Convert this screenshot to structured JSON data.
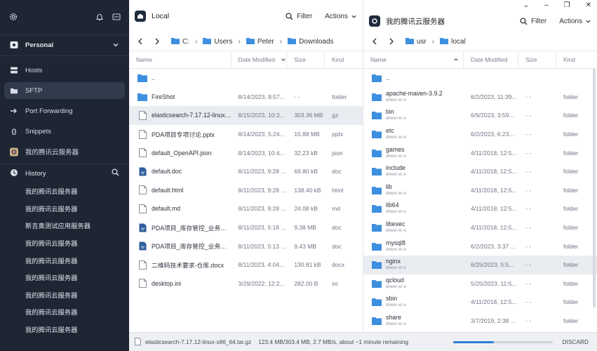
{
  "sidebar": {
    "personal_label": "Personal",
    "nav": [
      {
        "label": "Hosts",
        "icon": "hosts-icon"
      },
      {
        "label": "SFTP",
        "icon": "folder-icon",
        "active": true
      },
      {
        "label": "Port Forwarding",
        "icon": "port-forwarding-icon"
      },
      {
        "label": "Snippets",
        "icon": "snippets-icon"
      },
      {
        "label": "我的腾讯云服务器",
        "icon": "server-icon"
      }
    ],
    "history_label": "History",
    "history": [
      "我的腾讯云服务器",
      "我的腾讯云服务器",
      "新吉奥测试应用服务器",
      "我的腾讯云服务器",
      "我的腾讯云服务器",
      "我的腾讯云服务器",
      "我的腾讯云服务器",
      "我的腾讯云服务器",
      "我的腾讯云服务器"
    ]
  },
  "left_pane": {
    "host": "Local",
    "filter_label": "Filter",
    "actions_label": "Actions",
    "breadcrumb": [
      "C:",
      "Users",
      "Peter",
      "Downloads"
    ],
    "columns": {
      "name": "Name",
      "date": "Date Modified",
      "size": "Size",
      "kind": "Kind"
    },
    "rows": [
      {
        "name": "..",
        "date": "",
        "size": "",
        "kind": "",
        "type": "folder"
      },
      {
        "name": "FireShot",
        "date": "8/14/2023, 8:57...",
        "size": "- -",
        "kind": "folder",
        "type": "folder"
      },
      {
        "name": "elasticsearch-7.17.12-linux-x8...",
        "date": "8/15/2023, 10:3...",
        "size": "303.36 MB",
        "kind": "gz",
        "type": "file",
        "selected": true
      },
      {
        "name": "PDA项目专项讨论.pptx",
        "date": "8/14/2023, 5:24...",
        "size": "15.88 MB",
        "kind": "pptx",
        "type": "file"
      },
      {
        "name": "default_OpenAPI.json",
        "date": "8/14/2023, 10:4...",
        "size": "32.23 kB",
        "kind": "json",
        "type": "file"
      },
      {
        "name": "default.doc",
        "date": "8/11/2023, 9:28 ...",
        "size": "69.80 kB",
        "kind": "doc",
        "type": "doc"
      },
      {
        "name": "default.html",
        "date": "8/11/2023, 9:28 ...",
        "size": "138.40 kB",
        "kind": "html",
        "type": "file"
      },
      {
        "name": "default.md",
        "date": "8/11/2023, 9:28 ...",
        "size": "24.08 kB",
        "kind": "md",
        "type": "file"
      },
      {
        "name": "PDA项目_库存管控_业务蓝...",
        "date": "8/11/2023, 5:18 ...",
        "size": "9.38 MB",
        "kind": "doc",
        "type": "doc"
      },
      {
        "name": "PDA项目_库存管控_业务蓝...",
        "date": "8/11/2023, 5:13 ...",
        "size": "9.43 MB",
        "kind": "doc",
        "type": "doc"
      },
      {
        "name": "二维码技术要求-仓库.docx",
        "date": "8/11/2023, 4:04...",
        "size": "130.81 kB",
        "kind": "docx",
        "type": "file"
      },
      {
        "name": "desktop.ini",
        "date": "3/29/2022, 12:2...",
        "size": "282.00 B",
        "kind": "ini",
        "type": "file"
      }
    ]
  },
  "right_pane": {
    "host": "我的腾讯云服务器",
    "filter_label": "Filter",
    "actions_label": "Actions",
    "breadcrumb": [
      "usr",
      "local"
    ],
    "columns": {
      "name": "Name",
      "date": "Date Modified",
      "size": "Size",
      "kind": "Kind"
    },
    "rows": [
      {
        "name": "..",
        "perm": "",
        "date": "",
        "size": "",
        "kind": ""
      },
      {
        "name": "apache-maven-3.9.2",
        "perm": "drwxr-xr-x",
        "date": "6/2/2023, 11:39...",
        "size": "- -",
        "kind": "folder"
      },
      {
        "name": "bin",
        "perm": "drwxr-xr-x",
        "date": "6/9/2023, 3:59...",
        "size": "- -",
        "kind": "folder"
      },
      {
        "name": "etc",
        "perm": "drwxr-xr-x",
        "date": "6/2/2023, 6:23...",
        "size": "- -",
        "kind": "folder"
      },
      {
        "name": "games",
        "perm": "drwxr-xr-x",
        "date": "4/11/2018, 12:5...",
        "size": "- -",
        "kind": "folder"
      },
      {
        "name": "include",
        "perm": "drwxr-xr-x",
        "date": "4/11/2018, 12:5...",
        "size": "- -",
        "kind": "folder"
      },
      {
        "name": "lib",
        "perm": "drwxr-xr-x",
        "date": "4/11/2018, 12:5...",
        "size": "- -",
        "kind": "folder"
      },
      {
        "name": "lib64",
        "perm": "drwxr-xr-x",
        "date": "4/11/2018, 12:5...",
        "size": "- -",
        "kind": "folder"
      },
      {
        "name": "libexec",
        "perm": "drwxr-xr-x",
        "date": "4/11/2018, 12:5...",
        "size": "- -",
        "kind": "folder"
      },
      {
        "name": "mysql8",
        "perm": "drwxr-xr-x",
        "date": "6/2/2023, 3:37 ...",
        "size": "- -",
        "kind": "folder"
      },
      {
        "name": "nginx",
        "perm": "drwxr-xr-x",
        "date": "6/25/2023, 5:5...",
        "size": "- -",
        "kind": "folder",
        "selected": true
      },
      {
        "name": "qcloud",
        "perm": "drwxr-xr-x",
        "date": "5/25/2023, 11:5...",
        "size": "- -",
        "kind": "folder"
      },
      {
        "name": "sbin",
        "perm": "drwxr-xr-x",
        "date": "4/11/2018, 12:5...",
        "size": "- -",
        "kind": "folder"
      },
      {
        "name": "share",
        "perm": "drwxr-xr-x",
        "date": "3/7/2019, 2:38 ...",
        "size": "- -",
        "kind": "folder"
      }
    ]
  },
  "status": {
    "filename": "elasticsearch-7.17.12-linux-x86_64.tar.gz",
    "text": "123.4 MB/303.4 MB, 2.7 MB/s, about ~1 minute remaining",
    "progress_fraction": 0.41,
    "discard_label": "DISCARD"
  },
  "colors": {
    "folder": "#3d8fe0",
    "accent": "#2f7fd7",
    "sidebar_bg": "#1e2533"
  }
}
